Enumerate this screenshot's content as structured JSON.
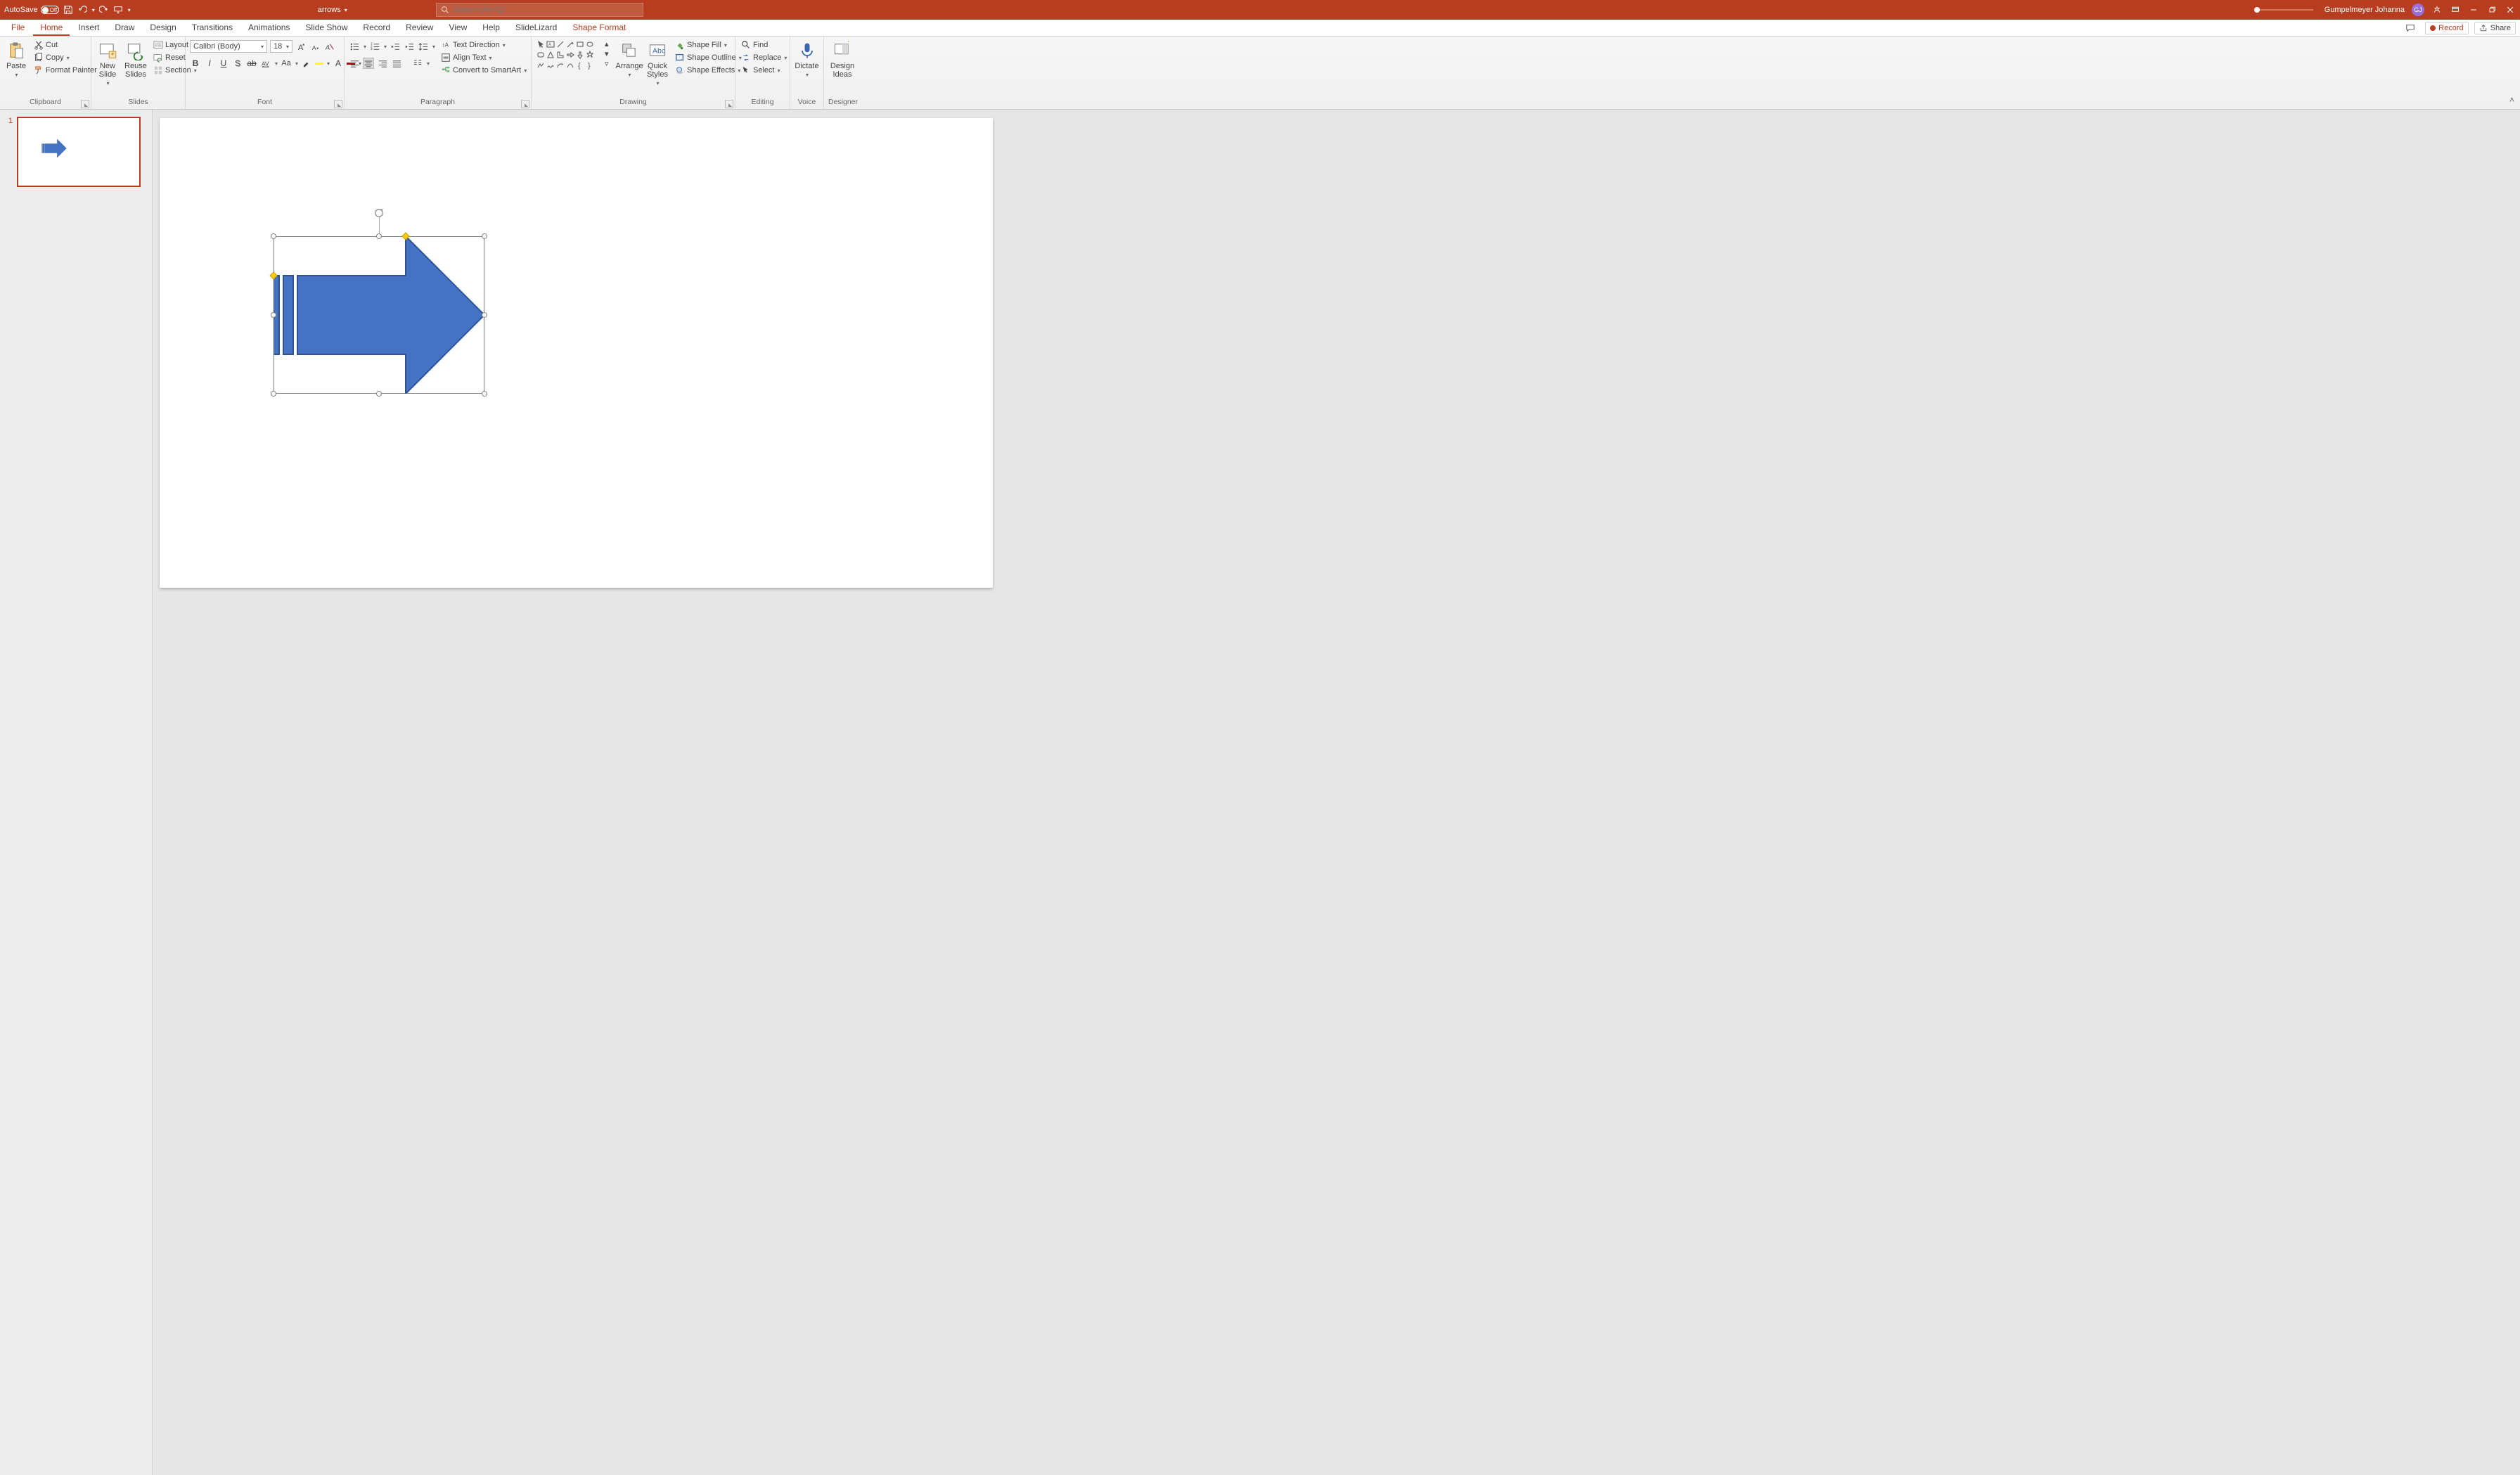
{
  "title": {
    "autosave": "AutoSave",
    "autosave_state": "Off",
    "document": "arrows",
    "search_placeholder": "Search (Alt+Q)",
    "user": "Gumpelmeyer Johanna",
    "user_initials": "GJ"
  },
  "tabs": {
    "file": "File",
    "home": "Home",
    "insert": "Insert",
    "draw": "Draw",
    "design": "Design",
    "transitions": "Transitions",
    "animations": "Animations",
    "slideshow": "Slide Show",
    "record_tab": "Record",
    "review": "Review",
    "view": "View",
    "help": "Help",
    "slidelizard": "SlideLizard",
    "shapeformat": "Shape Format",
    "record_btn": "Record",
    "share": "Share"
  },
  "ribbon": {
    "clipboard": {
      "label": "Clipboard",
      "paste": "Paste",
      "cut": "Cut",
      "copy": "Copy",
      "formatpainter": "Format Painter"
    },
    "slides": {
      "label": "Slides",
      "newslide": "New\nSlide",
      "reuseslides": "Reuse\nSlides",
      "layout": "Layout",
      "reset": "Reset",
      "section": "Section"
    },
    "font": {
      "label": "Font",
      "name": "Calibri (Body)",
      "size": "18"
    },
    "paragraph": {
      "label": "Paragraph",
      "textdir": "Text Direction",
      "aligntext": "Align Text",
      "smartart": "Convert to SmartArt"
    },
    "drawing": {
      "label": "Drawing",
      "arrange": "Arrange",
      "quickstyles": "Quick\nStyles",
      "fill": "Shape Fill",
      "outline": "Shape Outline",
      "effects": "Shape Effects"
    },
    "editing": {
      "label": "Editing",
      "find": "Find",
      "replace": "Replace",
      "select": "Select"
    },
    "voice": {
      "label": "Voice",
      "dictate": "Dictate"
    },
    "designer": {
      "label": "Designer",
      "designideas": "Design\nIdeas"
    }
  },
  "thumbs": {
    "n1": "1"
  },
  "colors": {
    "accent": "#b83c1f",
    "shape_fill": "#4472c4",
    "shape_stroke": "#2f528f"
  }
}
